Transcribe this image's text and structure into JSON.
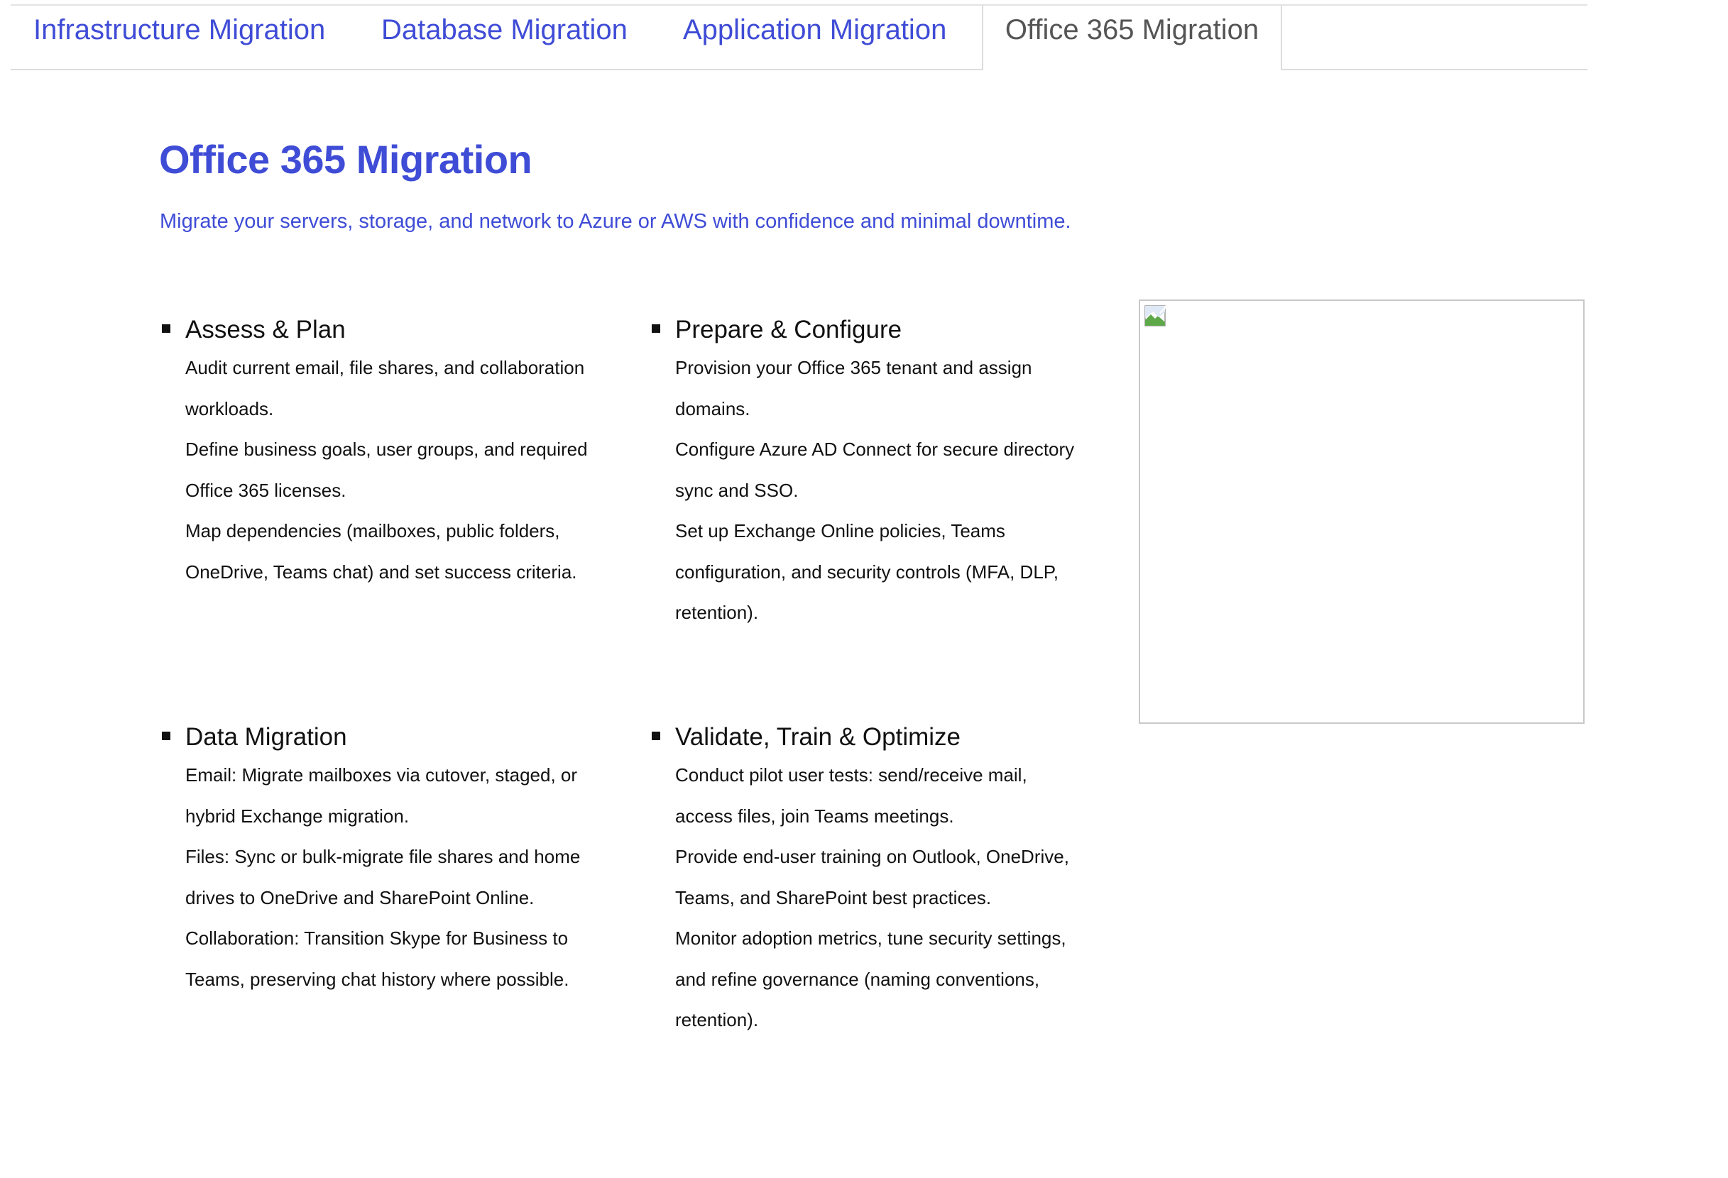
{
  "tabs": [
    {
      "label": "Infrastructure Migration",
      "active": false
    },
    {
      "label": "Database Migration",
      "active": false
    },
    {
      "label": "Application Migration",
      "active": false
    },
    {
      "label": "Office 365 Migration",
      "active": true
    }
  ],
  "page": {
    "title": "Office 365 Migration",
    "subtitle": "Migrate your servers, storage, and network to Azure or AWS with confidence and minimal downtime."
  },
  "steps": [
    {
      "title": "Assess & Plan",
      "items": [
        "Audit current email, file shares, and collaboration workloads.",
        "Define business goals, user groups, and required Office 365 licenses.",
        "Map dependencies (mailboxes, public folders, OneDrive, Teams chat) and set success criteria."
      ]
    },
    {
      "title": "Prepare & Configure",
      "items": [
        "Provision your Office 365 tenant and assign domains.",
        "Configure Azure AD Connect for secure directory sync and SSO.",
        "Set up Exchange Online policies, Teams configuration, and security controls (MFA, DLP, retention)."
      ]
    },
    {
      "title": "Data Migration",
      "items": [
        "Email: Migrate mailboxes via cutover, staged, or hybrid Exchange migration.",
        "Files: Sync or bulk-migrate file shares and home drives to OneDrive and SharePoint Online.",
        "Collaboration: Transition Skype for Business to Teams, preserving chat history where possible."
      ]
    },
    {
      "title": "Validate, Train & Optimize",
      "items": [
        "Conduct pilot user tests: send/receive mail, access files, join Teams meetings.",
        "Provide end-user training on Outlook, OneDrive, Teams, and SharePoint best practices.",
        "Monitor adoption metrics, tune security settings, and refine governance (naming conventions, retention)."
      ]
    }
  ],
  "image": {
    "icon": "broken-image-icon"
  },
  "colors": {
    "accent": "#3f4cd6",
    "active_tab_text": "#555555",
    "body_text": "#111111",
    "divider": "#dcdcdc"
  }
}
